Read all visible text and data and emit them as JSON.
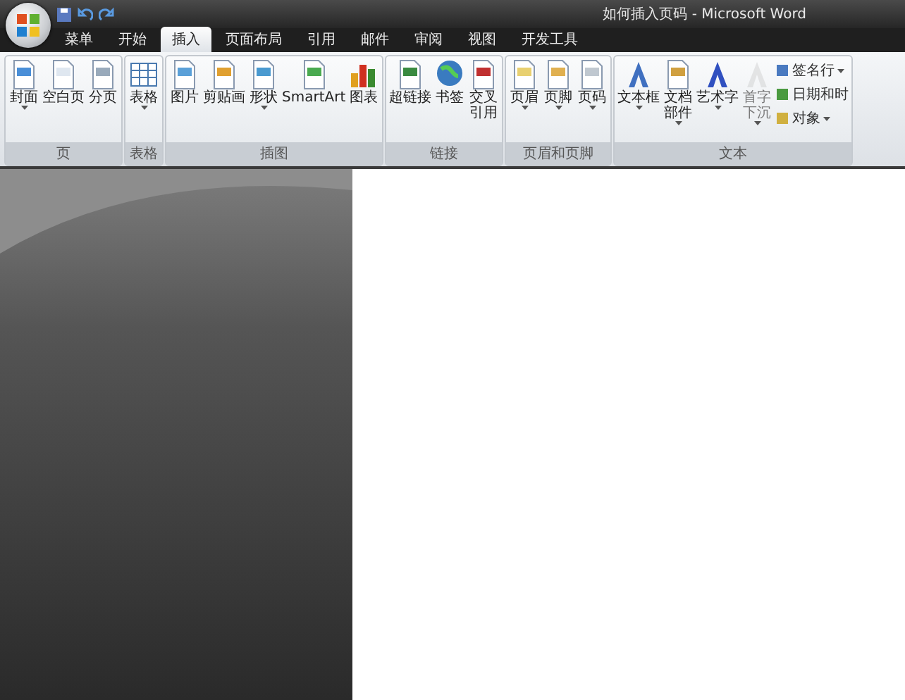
{
  "window": {
    "title": "如何插入页码 - Microsoft Word"
  },
  "tabs": [
    {
      "label": "菜单",
      "selected": false
    },
    {
      "label": "开始",
      "selected": false
    },
    {
      "label": "插入",
      "selected": true
    },
    {
      "label": "页面布局",
      "selected": false
    },
    {
      "label": "引用",
      "selected": false
    },
    {
      "label": "邮件",
      "selected": false
    },
    {
      "label": "审阅",
      "selected": false
    },
    {
      "label": "视图",
      "selected": false
    },
    {
      "label": "开发工具",
      "selected": false
    }
  ],
  "groups": [
    {
      "label": "页",
      "items": [
        {
          "kind": "large",
          "label": "封面",
          "dropdown": true,
          "disabled": false
        },
        {
          "kind": "large",
          "label": "空白页",
          "dropdown": false,
          "disabled": false
        },
        {
          "kind": "large",
          "label": "分页",
          "dropdown": false,
          "disabled": false
        }
      ]
    },
    {
      "label": "表格",
      "items": [
        {
          "kind": "large",
          "label": "表格",
          "dropdown": true,
          "disabled": false
        }
      ]
    },
    {
      "label": "插图",
      "items": [
        {
          "kind": "large",
          "label": "图片",
          "dropdown": false,
          "disabled": false
        },
        {
          "kind": "large",
          "label": "剪贴画",
          "dropdown": false,
          "disabled": false
        },
        {
          "kind": "large",
          "label": "形状",
          "dropdown": true,
          "disabled": false
        },
        {
          "kind": "large",
          "label": "SmartArt",
          "dropdown": false,
          "disabled": false
        },
        {
          "kind": "large",
          "label": "图表",
          "dropdown": false,
          "disabled": false
        }
      ]
    },
    {
      "label": "链接",
      "items": [
        {
          "kind": "large",
          "label": "超链接",
          "dropdown": false,
          "disabled": false
        },
        {
          "kind": "large",
          "label": "书签",
          "dropdown": false,
          "disabled": false
        },
        {
          "kind": "large",
          "label": "交叉引用",
          "dropdown": false,
          "disabled": false
        }
      ]
    },
    {
      "label": "页眉和页脚",
      "items": [
        {
          "kind": "large",
          "label": "页眉",
          "dropdown": true,
          "disabled": false
        },
        {
          "kind": "large",
          "label": "页脚",
          "dropdown": true,
          "disabled": false
        },
        {
          "kind": "large",
          "label": "页码",
          "dropdown": true,
          "disabled": false
        }
      ]
    },
    {
      "label": "文本",
      "items": [
        {
          "kind": "large",
          "label": "文本框",
          "dropdown": true,
          "disabled": false
        },
        {
          "kind": "large",
          "label": "文档部件",
          "dropdown": true,
          "disabled": false
        },
        {
          "kind": "large",
          "label": "艺术字",
          "dropdown": true,
          "disabled": false
        },
        {
          "kind": "large",
          "label": "首字下沉",
          "dropdown": true,
          "disabled": true
        },
        {
          "kind": "small",
          "label": "签名行",
          "dropdown": true,
          "disabled": false
        },
        {
          "kind": "small",
          "label": "日期和时",
          "dropdown": false,
          "disabled": false
        },
        {
          "kind": "small",
          "label": "对象",
          "dropdown": true,
          "disabled": false
        }
      ]
    }
  ]
}
